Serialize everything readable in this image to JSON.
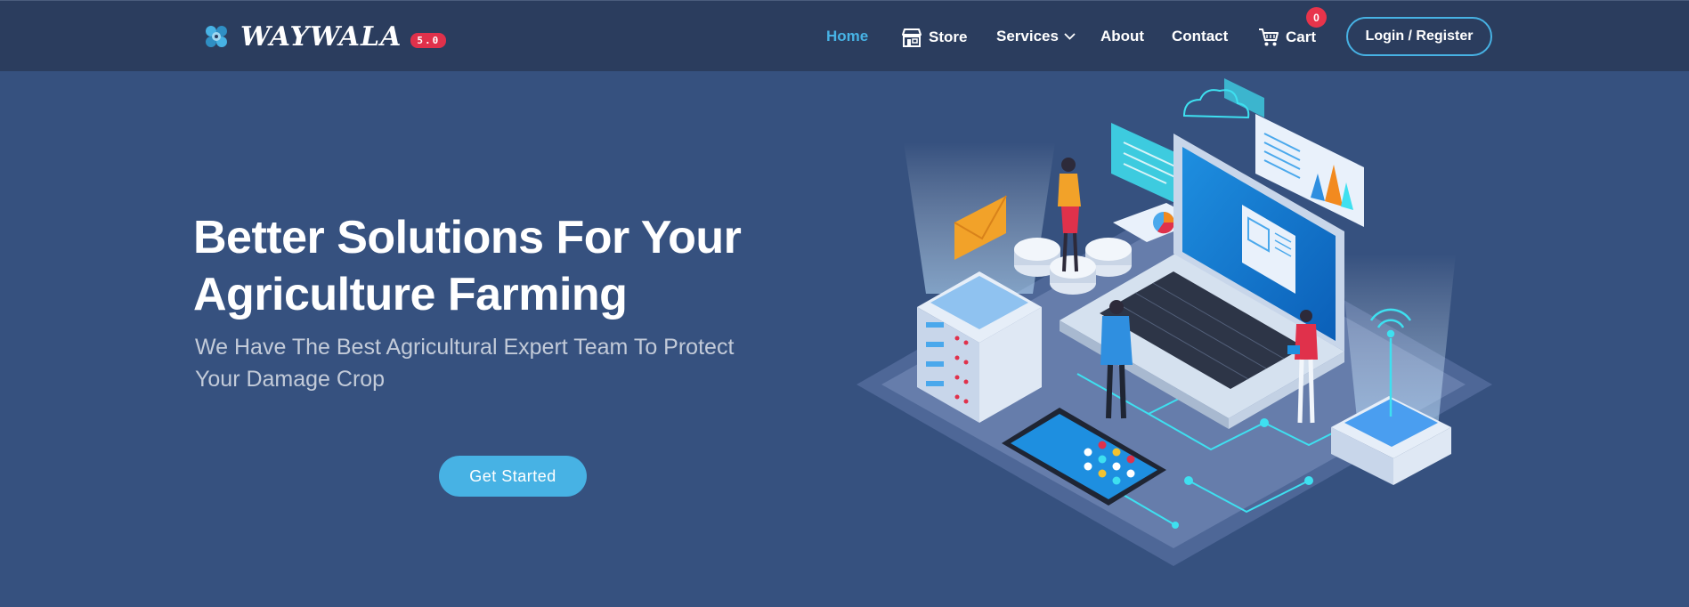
{
  "brand": {
    "name": "WAYWALA",
    "version": "5.0",
    "logo_icon": "gear-cluster-icon"
  },
  "nav": {
    "home": "Home",
    "store": "Store",
    "services": "Services",
    "about": "About",
    "contact": "Contact",
    "cart": "Cart",
    "cart_count": "0",
    "login": "Login  / Register",
    "store_icon": "store-icon",
    "cart_icon": "cart-icon",
    "services_icon": "chevron-down-icon"
  },
  "hero": {
    "title_line1": "Better Solutions For Your",
    "title_line2": "Agriculture Farming",
    "subtitle_line1": "We Have The Best Agricultural Expert Team To Protect",
    "subtitle_line2": "Your Damage Crop",
    "cta": "Get Started"
  },
  "colors": {
    "page_background": "#36517f",
    "navbar_background": "#2b3d5e",
    "accent": "#47b2e4",
    "badge_red": "#e0314b"
  }
}
